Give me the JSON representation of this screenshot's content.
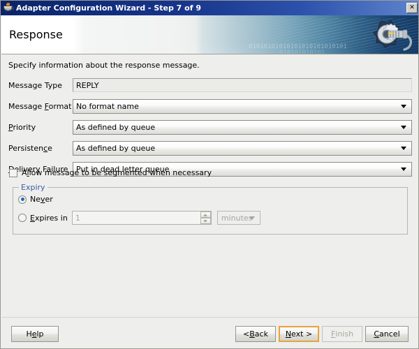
{
  "window": {
    "title": "Adapter Configuration Wizard - Step 7 of 9",
    "app_icon": "java-cup-icon",
    "close_label": "✕"
  },
  "banner": {
    "heading": "Response",
    "binary_line1": "01010101010101010101010101",
    "binary_line2": "010101010101",
    "tool_icon": "gear-wrench-icon"
  },
  "content": {
    "intro": "Specify information about the response message.",
    "fields": [
      {
        "id": "message-type",
        "label_pre": "Message Type",
        "label_mn": "",
        "label_post": "",
        "type": "textfield",
        "value": "REPLY"
      },
      {
        "id": "message-format",
        "label_pre": "Message ",
        "label_mn": "F",
        "label_post": "ormat",
        "type": "combo",
        "value": "No format name"
      },
      {
        "id": "priority",
        "label_pre": "",
        "label_mn": "P",
        "label_post": "riority",
        "type": "combo",
        "value": "As defined by queue"
      },
      {
        "id": "persistence",
        "label_pre": "Persisten",
        "label_mn": "c",
        "label_post": "e",
        "type": "combo",
        "value": "As defined by queue"
      },
      {
        "id": "delivery-failure",
        "label_pre": "",
        "label_mn": "D",
        "label_post": "elivery Failure",
        "type": "combo",
        "value": "Put in dead letter queue"
      }
    ],
    "segment_checkbox": {
      "pre": "A",
      "mn": "l",
      "post": "low message to be segmented when necessary",
      "checked": false
    },
    "expiry": {
      "legend": "Expiry",
      "never": {
        "pre": "Ne",
        "mn": "v",
        "post": "er",
        "selected": true
      },
      "expires_in": {
        "pre": "",
        "mn": "E",
        "post": "xpires in",
        "selected": false
      },
      "spinner_value": "1",
      "unit_value": "minutes"
    }
  },
  "buttons": {
    "help": {
      "pre": "H",
      "mn": "e",
      "post": "lp",
      "enabled": true
    },
    "back": {
      "pre": "< ",
      "mn": "B",
      "post": "ack",
      "enabled": true
    },
    "next": {
      "pre": "",
      "mn": "N",
      "post": "ext >",
      "enabled": true,
      "default": true
    },
    "finish": {
      "pre": "",
      "mn": "F",
      "post": "inish",
      "enabled": false
    },
    "cancel": {
      "pre": "",
      "mn": "C",
      "post": "ancel",
      "enabled": true
    }
  },
  "colors": {
    "titlebar_start": "#0a246a",
    "titlebar_end": "#5f84cc",
    "dialog_bg": "#eeeeec",
    "legend_blue": "#3a5fa0",
    "default_button_border": "#e8a33d",
    "radio_dot": "#2a64c8"
  }
}
